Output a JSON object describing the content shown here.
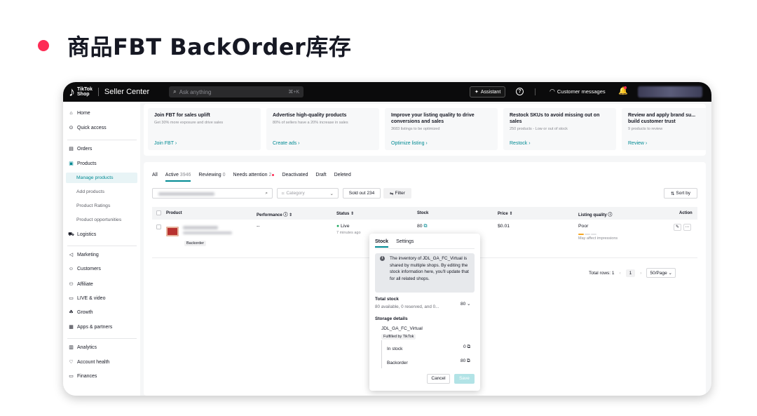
{
  "slide": {
    "title": "商品FBT BackOrder库存",
    "accent": "#fe2c55"
  },
  "topbar": {
    "brand_top": "TikTok",
    "brand_bottom": "Shop",
    "app_name": "Seller Center",
    "search_placeholder": "Ask anything",
    "search_shortcut": "⌘+K",
    "assistant": "Assistant",
    "help": "?",
    "customer_messages": "Customer messages"
  },
  "sidebar": {
    "groups": [
      {
        "label": "Home",
        "icon": "home-icon"
      },
      {
        "label": "Quick access",
        "icon": "compass-icon"
      },
      {
        "label": "Orders",
        "icon": "clipboard-icon"
      },
      {
        "label": "Products",
        "icon": "box-icon"
      },
      {
        "label": "Logistics",
        "icon": "truck-icon"
      },
      {
        "label": "Marketing",
        "icon": "megaphone-icon"
      },
      {
        "label": "Customers",
        "icon": "people-icon"
      },
      {
        "label": "Affiliate",
        "icon": "affiliate-icon"
      },
      {
        "label": "LIVE & video",
        "icon": "video-icon"
      },
      {
        "label": "Growth",
        "icon": "growth-icon"
      },
      {
        "label": "Apps & partners",
        "icon": "grid-icon"
      },
      {
        "label": "Analytics",
        "icon": "analytics-icon"
      },
      {
        "label": "Account health",
        "icon": "shield-icon"
      },
      {
        "label": "Finances",
        "icon": "wallet-icon"
      }
    ],
    "product_sub": [
      "Manage products",
      "Add products",
      "Product Ratings",
      "Product opportunities"
    ]
  },
  "cards": [
    {
      "title": "Join FBT for sales uplift",
      "desc": "Get 30% more exposure and drive sales",
      "link": "Join FBT  ›"
    },
    {
      "title": "Advertise high-quality products",
      "desc": "80% of sellers have a 20% increase in sales",
      "link": "Create ads  ›"
    },
    {
      "title": "Improve your listing quality to drive conversions and sales",
      "desc": "3683 listings to be optimized",
      "link": "Optimize listing  ›"
    },
    {
      "title": "Restock SKUs to avoid missing out on sales",
      "desc": "250 products - Low or out of stock",
      "link": "Restock  ›"
    },
    {
      "title": "Review and apply brand su... build customer trust",
      "desc": "9 products to review",
      "link": "Review  ›"
    }
  ],
  "tabs": [
    {
      "label": "All",
      "count": ""
    },
    {
      "label": "Active",
      "count": "3946"
    },
    {
      "label": "Reviewing",
      "count": "0"
    },
    {
      "label": "Needs attention",
      "count": "2"
    },
    {
      "label": "Deactivated",
      "count": ""
    },
    {
      "label": "Draft",
      "count": ""
    },
    {
      "label": "Deleted",
      "count": ""
    }
  ],
  "filters": {
    "category": "Category",
    "sold_out": "Sold out 234",
    "filter": "Filter",
    "sort": "Sort by"
  },
  "table": {
    "headers": [
      "Product",
      "Performance ⓘ ⇕",
      "Status ⇕",
      "Stock",
      "Price ⇕",
      "Listing quality ⓘ",
      "Action"
    ],
    "row": {
      "badge": "Backorder",
      "performance": "--",
      "status": "Live",
      "status_time": "7 minutes ago",
      "stock": "80",
      "price": "$0.01",
      "quality": "Poor",
      "quality_note": "May affect impressions"
    },
    "total": "Total rows: 1",
    "page": "1",
    "per_page": "50/Page"
  },
  "popover": {
    "tabs": [
      "Stock",
      "Settings"
    ],
    "info": "The inventory of JDL_GA_FC_Virtual is shared by multiple shops. By editing the stock information here, you'll update that for all related shops.",
    "total_label": "Total stock",
    "total_value": "80",
    "total_detail": "80 available, 0 reserved, and 0...",
    "storage_label": "Storage details",
    "warehouse": "JDL_GA_FC_Virtual",
    "fulfilled": "Fulfilled by TikTok",
    "in_stock_label": "In stock",
    "in_stock_value": "0",
    "backorder_label": "Backorder",
    "backorder_value": "80",
    "cancel": "Cancel",
    "save": "Save"
  }
}
